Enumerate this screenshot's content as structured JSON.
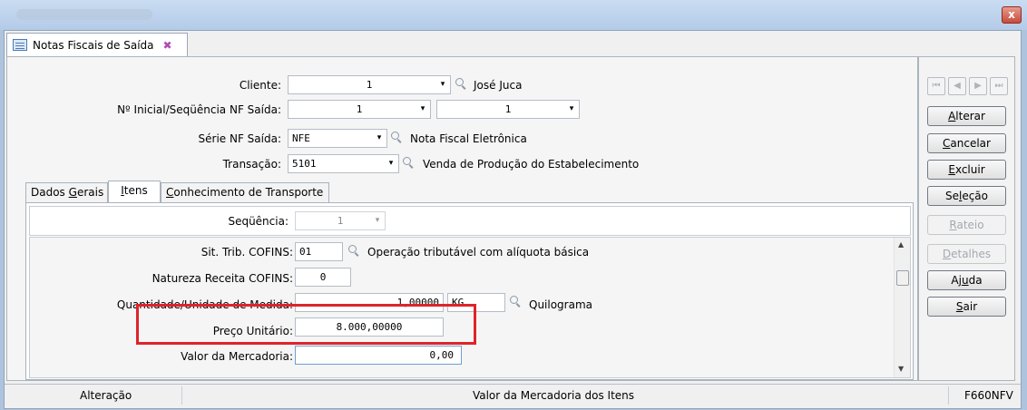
{
  "window": {
    "close_label": "x"
  },
  "doc_tab": {
    "title": "Notas Fiscais de Saída",
    "close": "✖"
  },
  "header": {
    "cliente": {
      "label": "Cliente:",
      "value": "1",
      "desc": "José Juca"
    },
    "nf": {
      "label": "Nº Inicial/Seqüência NF Saída:",
      "value1": "1",
      "value2": "1"
    },
    "serie": {
      "label": "Série NF Saída:",
      "value": "NFE",
      "desc": "Nota Fiscal Eletrônica"
    },
    "transacao": {
      "label": "Transação:",
      "value": "5101",
      "desc": "Venda de Produção do Estabelecimento"
    }
  },
  "tabs": {
    "dados_gerais": {
      "pre": "Dados ",
      "u": "G",
      "post": "erais"
    },
    "itens": {
      "u": "I",
      "post": "tens"
    },
    "conhecimento": {
      "u": "C",
      "post": "onhecimento de Transporte"
    }
  },
  "sequencia": {
    "label": "Seqüência:",
    "value": "1"
  },
  "items": {
    "sit_trib": {
      "label": "Sit. Trib. COFINS:",
      "value": "01",
      "desc": "Operação tributável com alíquota básica"
    },
    "natureza": {
      "label": "Natureza Receita COFINS:",
      "value": "0"
    },
    "quantidade": {
      "label": "Quantidade/Unidade de Medida:",
      "value": "1,00000",
      "unit": "KG",
      "desc": "Quilograma"
    },
    "preco": {
      "label": "Preço Unitário:",
      "value": "8.000,00000"
    },
    "valor": {
      "label": "Valor da Mercadoria:",
      "value": "0,00"
    }
  },
  "side_buttons": {
    "alterar": {
      "u": "A",
      "post": "lterar"
    },
    "cancelar": {
      "u": "C",
      "post": "ancelar"
    },
    "excluir": {
      "u": "E",
      "post": "xcluir"
    },
    "selecao": {
      "pre": "Se",
      "u": "l",
      "post": "eção"
    },
    "rateio": {
      "u": "R",
      "post": "ateio"
    },
    "detalhes": {
      "u": "D",
      "post": "etalhes"
    },
    "ajuda": {
      "pre": "Aj",
      "u": "u",
      "post": "da"
    },
    "sair": {
      "u": "S",
      "post": "air"
    }
  },
  "statusbar": {
    "mode": "Alteração",
    "hint": "Valor da Mercadoria dos Itens",
    "form_code": "F660NFV"
  },
  "colors": {
    "highlight": "#e0232b",
    "title_gradient": "#b4cbe8"
  }
}
